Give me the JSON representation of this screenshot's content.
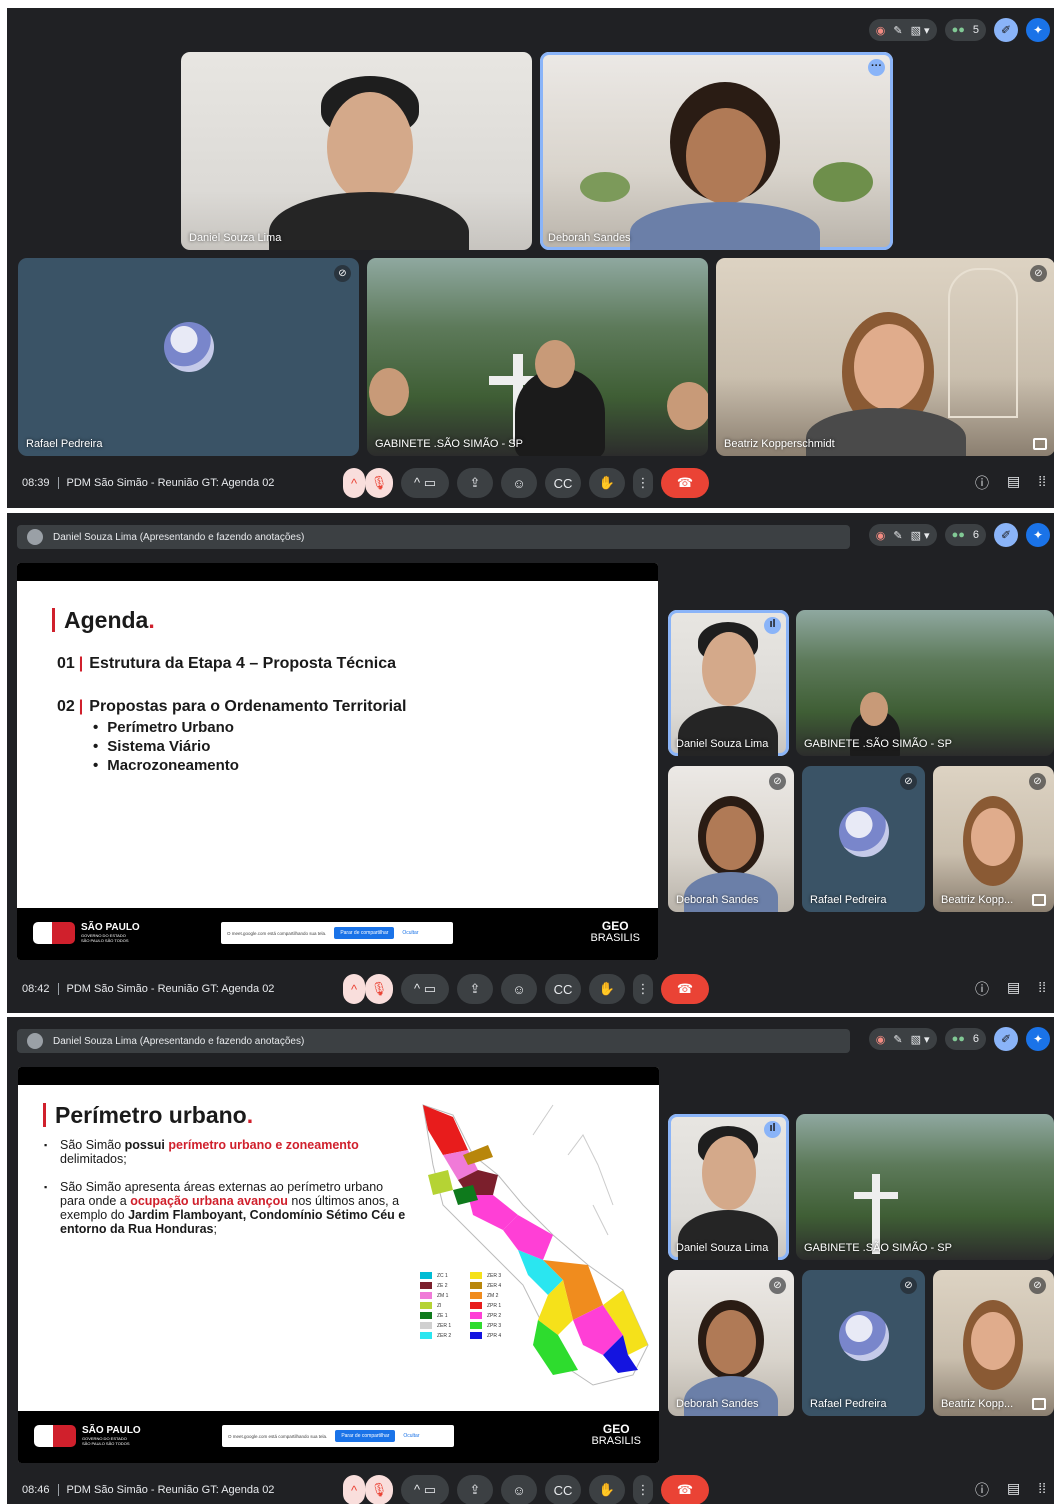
{
  "shots": [
    {
      "time": "08:39",
      "meeting_title": "PDM São Simão - Reunião GT: Agenda 02",
      "participant_count": "5",
      "tiles": [
        {
          "name": "Daniel Souza Lima"
        },
        {
          "name": "Deborah Sandes"
        },
        {
          "name": "Rafael Pedreira"
        },
        {
          "name": "GABINETE .SÃO SIMÃO - SP"
        },
        {
          "name": "Beatriz Kopperschmidt"
        }
      ]
    },
    {
      "time": "08:42",
      "meeting_title": "PDM São Simão - Reunião GT: Agenda 02",
      "participant_count": "6",
      "presenter": "Daniel Souza Lima (Apresentando e fazendo anotações)",
      "tiles": [
        {
          "name": "Daniel Souza Lima"
        },
        {
          "name": "GABINETE .SÃO SIMÃO - SP"
        },
        {
          "name": "Deborah Sandes"
        },
        {
          "name": "Rafael Pedreira"
        },
        {
          "name": "Beatriz Kopp..."
        }
      ],
      "slide": {
        "title": "Agenda",
        "title_dot": ".",
        "item1_num": "01",
        "item1_text": "Estrutura da Etapa 4 – Proposta Técnica",
        "item2_num": "02",
        "item2_text": "Propostas para o Ordenamento Territorial",
        "sub_items": [
          "Perímetro Urbano",
          "Sistema Viário",
          "Macrozoneamento"
        ]
      }
    },
    {
      "time": "08:46",
      "meeting_title": "PDM São Simão - Reunião GT: Agenda 02",
      "participant_count": "6",
      "presenter": "Daniel Souza Lima (Apresentando e fazendo anotações)",
      "tiles": [
        {
          "name": "Daniel Souza Lima"
        },
        {
          "name": "GABINETE .SÃO SIMÃO - SP"
        },
        {
          "name": "Deborah Sandes"
        },
        {
          "name": "Rafael Pedreira"
        },
        {
          "name": "Beatriz Kopp..."
        }
      ],
      "slide": {
        "title": "Perímetro urbano",
        "title_dot": ".",
        "p1_a": "São Simão ",
        "p1_b": "possui ",
        "p1_c": "perímetro urbano e zoneamento",
        "p1_d": " delimitados;",
        "p2_a": "São Simão apresenta áreas externas ao perímetro urbano para onde a ",
        "p2_b": "ocupação urbana avançou",
        "p2_c": " nos últimos anos, a exemplo do ",
        "p2_d": "Jardim Flamboyant, Condomínio Sétimo Céu e entorno da Rua Honduras",
        "p2_e": ";",
        "legend": [
          {
            "label": "ZC 1",
            "color": "#00bcd4"
          },
          {
            "label": "ZER 3",
            "color": "#f5e11a"
          },
          {
            "label": "ZE 2",
            "color": "#7b1f2c"
          },
          {
            "label": "ZER 4",
            "color": "#b8860b"
          },
          {
            "label": "ZM 1",
            "color": "#f07ad8"
          },
          {
            "label": "ZM 2",
            "color": "#f08c1e"
          },
          {
            "label": "ZI",
            "color": "#b5d334"
          },
          {
            "label": "ZPR 1",
            "color": "#e81c1c"
          },
          {
            "label": "ZE 1",
            "color": "#0e7a1c"
          },
          {
            "label": "ZPR 2",
            "color": "#ff3fd6"
          },
          {
            "label": "ZER 1",
            "color": "#d0d0d0"
          },
          {
            "label": "ZPR 3",
            "color": "#2edc2e"
          },
          {
            "label": "ZER 2",
            "color": "#2ae6f0"
          },
          {
            "label": "ZPR 4",
            "color": "#1414e0"
          }
        ]
      }
    }
  ],
  "footer": {
    "sp_logo": "SÃO PAULO",
    "sp_sub": "GOVERNO DO ESTADO",
    "sp_sub2": "SÃO PAULO SÃO TODOS",
    "share_text": "O meet.google.com está compartilhando sua tela.",
    "stop_label": "Parar de compartilhar",
    "hide_label": "Ocultar",
    "geo_top": "GEO",
    "geo_bottom": "BRASILIS"
  },
  "colors": {
    "meet_bg": "#202124",
    "accent": "#8ab4f8",
    "end_call": "#ea4335",
    "brand_red": "#d0202c"
  },
  "icons": [
    "record-icon",
    "edit-icon",
    "no-present-icon",
    "people-icon",
    "pen-icon",
    "gemini-icon",
    "mic-off-icon",
    "camera-icon",
    "present-icon",
    "emoji-icon",
    "captions-icon",
    "hand-icon",
    "more-icon",
    "end-call-icon",
    "info-icon",
    "chat-icon",
    "apps-icon"
  ]
}
